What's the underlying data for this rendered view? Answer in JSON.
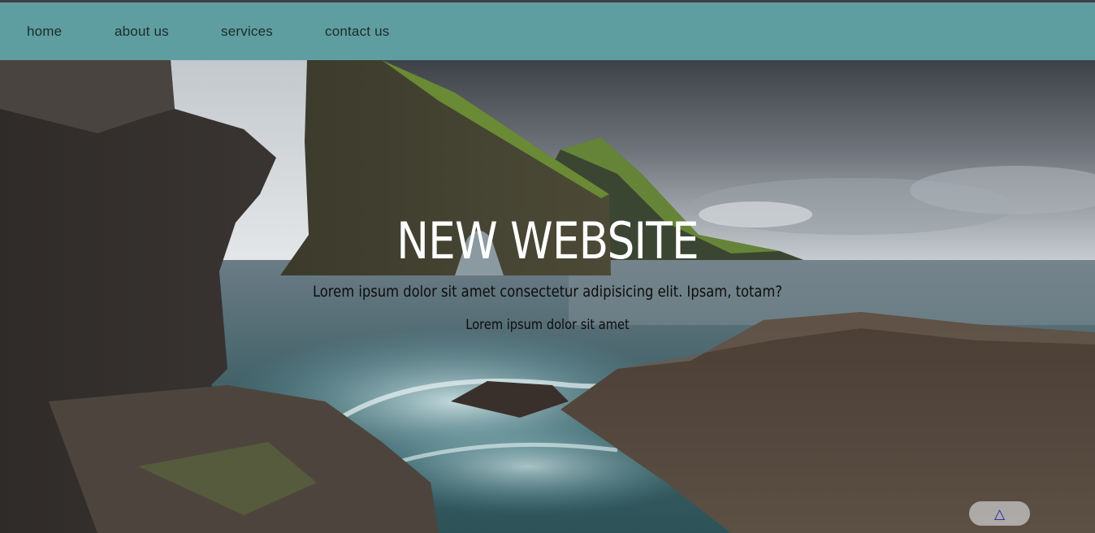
{
  "nav": {
    "items": [
      {
        "label": "home"
      },
      {
        "label": "about us"
      },
      {
        "label": "services"
      },
      {
        "label": "contact us"
      }
    ]
  },
  "hero": {
    "title": "NEW WEBSITE",
    "subtitle": "Lorem ipsum dolor sit amet consectetur adipisicing elit. Ipsam, totam?",
    "tagline": "Lorem ipsum dolor sit amet"
  },
  "scroll_top": {
    "glyph": "△",
    "icon": "triangle-up-icon"
  },
  "colors": {
    "navbar": "#5e9ea0",
    "nav_text": "#1e2a2a",
    "title": "#ffffff",
    "scroll_glyph": "#1e1ea8"
  }
}
